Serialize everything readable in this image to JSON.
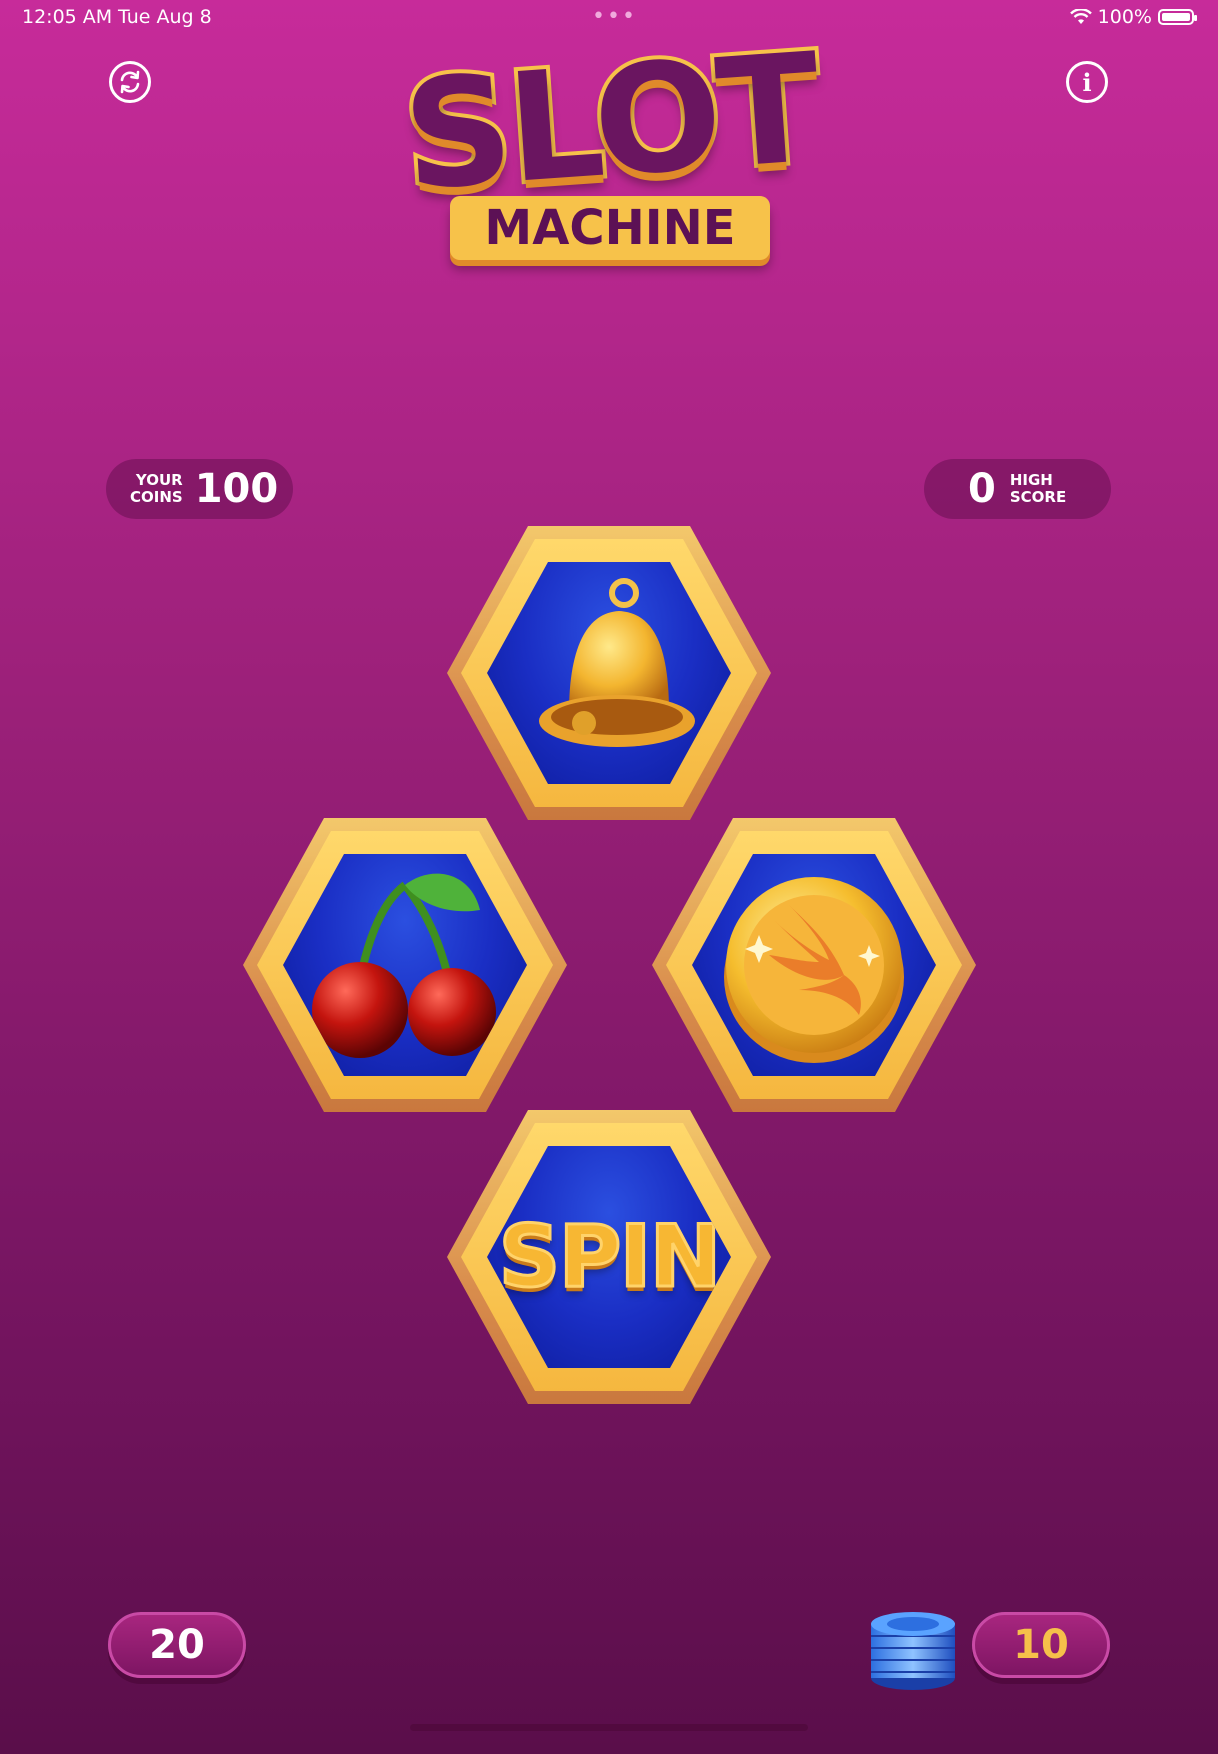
{
  "status_bar": {
    "time": "12:05 AM",
    "date": "Tue Aug 8",
    "dots": "•••",
    "battery": "100%"
  },
  "logo": {
    "line1": "SLOT",
    "line2": "MACHINE"
  },
  "coins": {
    "label_line1": "YOUR",
    "label_line2": "COINS",
    "value": "100"
  },
  "high_score": {
    "value": "0",
    "label_line1": "HIGH",
    "label_line2": "SCORE"
  },
  "reels": {
    "top": "bell-icon",
    "left": "cherry-icon",
    "right": "swift-coin-icon"
  },
  "spin": {
    "label": "SPIN"
  },
  "bets": {
    "bet_20": "20",
    "bet_10": "10"
  },
  "colors": {
    "background_top": "#c72b9a",
    "background_bottom": "#5a0e4a",
    "gold": "#f7c24a",
    "reel_blue": "#1a2ec4"
  }
}
